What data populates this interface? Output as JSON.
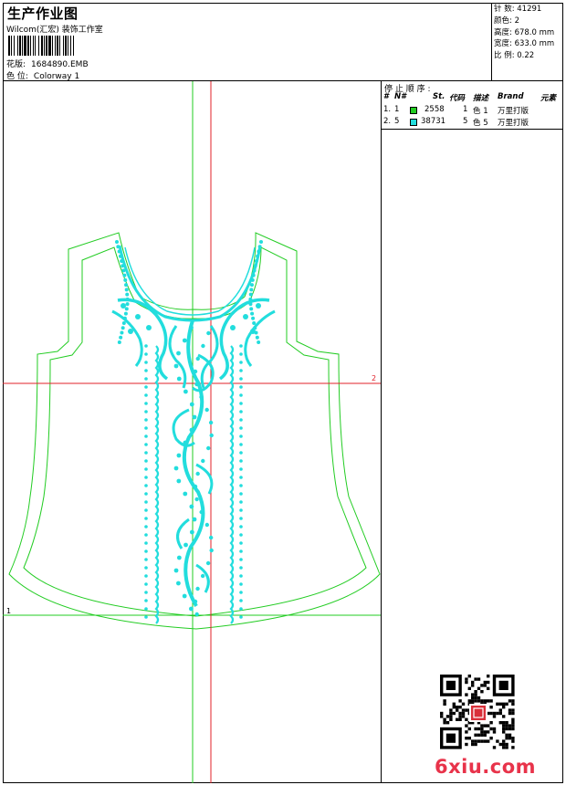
{
  "header": {
    "title": "生产作业图",
    "studio": "Wilcom(汇宏) 装饰工作室",
    "design_label": "花版:",
    "design_value": "1684890.EMB",
    "color_label": "色 位:",
    "color_value": "Colorway 1"
  },
  "stats": {
    "stitches": "针 数: 41291",
    "colors": "颜色: 2",
    "height": "高度: 678.0 mm",
    "width": "宽度: 633.0 mm",
    "scale": "比 例: 0.22"
  },
  "stop_sequence": {
    "title": "停 止 顺 序 :",
    "columns": [
      "#",
      "N#",
      "St.",
      "代码",
      "描述",
      "Brand",
      "元素"
    ],
    "rows": [
      {
        "index": "1.",
        "needle": "1",
        "color": "#22cc22",
        "stitches": "2558",
        "code": "1",
        "desc": "色 1",
        "brand": "万里打版",
        "element": ""
      },
      {
        "index": "2.",
        "needle": "5",
        "color": "#22dddd",
        "stitches": "38731",
        "code": "5",
        "desc": "色 5",
        "brand": "万里打版",
        "element": ""
      }
    ]
  },
  "canvas": {
    "outline_color": "#22cc22",
    "embroidery_color": "#22dddd",
    "axis_color": "#e0202a",
    "axis_x_label": "2",
    "axis_y_label": "1"
  },
  "watermark": "6xiu.com"
}
